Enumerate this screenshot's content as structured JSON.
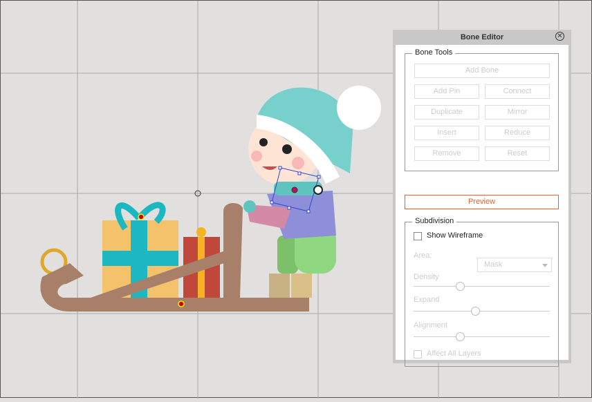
{
  "panel": {
    "title": "Bone Editor",
    "close_icon": "close-circle-icon",
    "bone_tools": {
      "label": "Bone Tools",
      "add_bone": "Add Bone",
      "add_pin": "Add Pin",
      "connect": "Connect",
      "duplicate": "Duplicate",
      "mirror": "Mirror",
      "insert": "Insert",
      "reduce": "Reduce",
      "remove": "Remove",
      "reset": "Reset"
    },
    "preview": "Preview",
    "subdivision": {
      "label": "Subdivision",
      "show_wireframe": "Show Wireframe",
      "show_wireframe_checked": false,
      "area_label": "Area:",
      "area_value": "Mask",
      "density_label": "Density",
      "density_percent": 34,
      "expand_label": "Expand",
      "expand_percent": 45,
      "alignment_label": "Alignment",
      "alignment_percent": 34,
      "affect_all_layers": "Affect All  Layers",
      "affect_all_checked": false
    }
  },
  "colors": {
    "accent": "#e8602c",
    "canvas": "#e1e0df"
  }
}
